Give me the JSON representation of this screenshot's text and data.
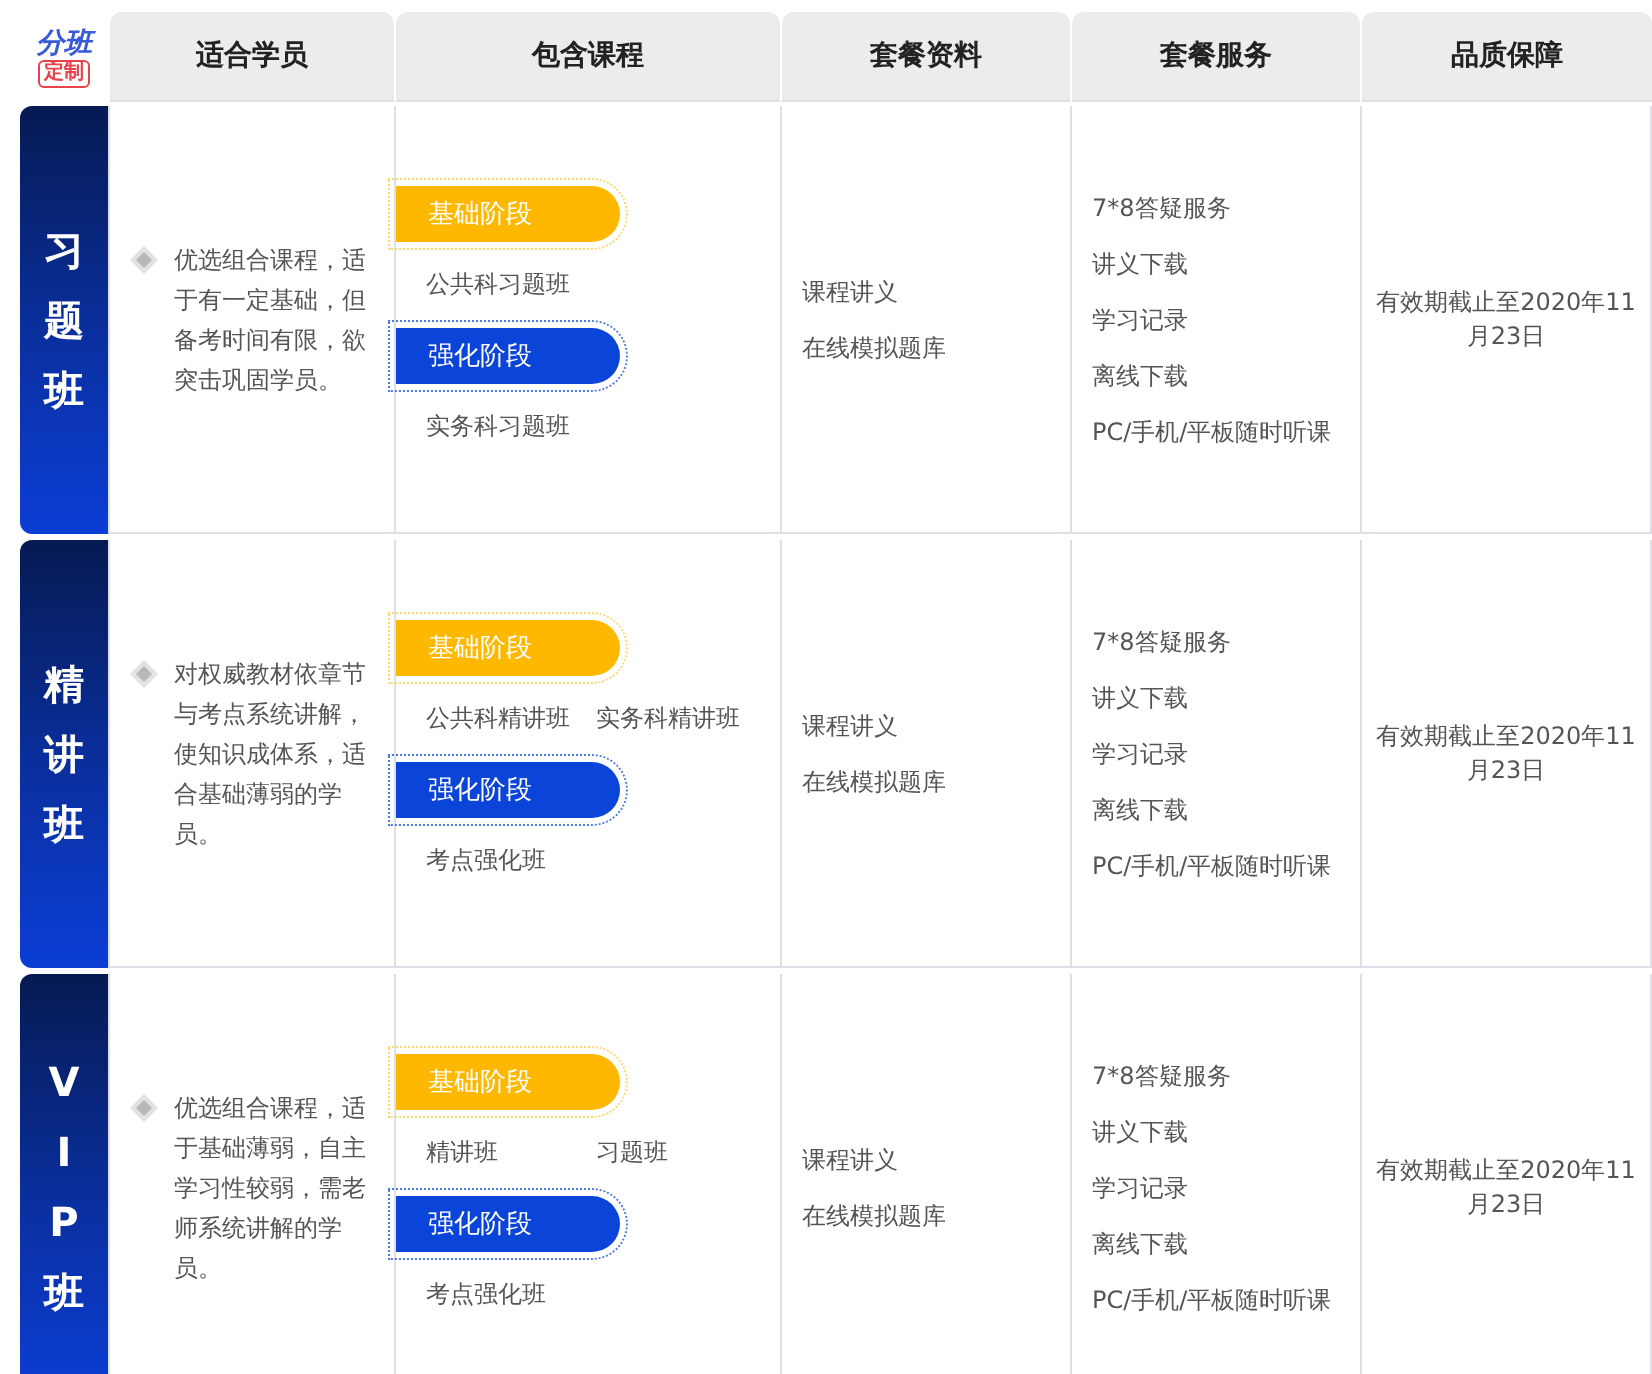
{
  "logo": {
    "top": "分班",
    "bottom": "定制"
  },
  "columns": [
    "适合学员",
    "包含课程",
    "套餐资料",
    "套餐服务",
    "品质保障"
  ],
  "rows": [
    {
      "name": "习题班",
      "audience": "优选组合课程，适于有一定基础，但备考时间有限，欲突击巩固学员。",
      "stages": [
        {
          "label": "基础阶段",
          "kind": "basic",
          "courses": [
            "公共科习题班"
          ]
        },
        {
          "label": "强化阶段",
          "kind": "intensive",
          "courses": [
            "实务科习题班"
          ]
        }
      ],
      "materials": [
        "课程讲义",
        "在线模拟题库"
      ],
      "services": [
        "7*8答疑服务",
        "讲义下载",
        "学习记录",
        "离线下载",
        "PC/手机/平板随时听课"
      ],
      "guarantee": "有效期截止至2020年11月23日"
    },
    {
      "name": "精讲班",
      "audience": "对权威教材依章节与考点系统讲解，使知识成体系，适合基础薄弱的学员。",
      "stages": [
        {
          "label": "基础阶段",
          "kind": "basic",
          "courses": [
            "公共科精讲班",
            "实务科精讲班"
          ]
        },
        {
          "label": "强化阶段",
          "kind": "intensive",
          "courses": [
            "考点强化班"
          ]
        }
      ],
      "materials": [
        "课程讲义",
        "在线模拟题库"
      ],
      "services": [
        "7*8答疑服务",
        "讲义下载",
        "学习记录",
        "离线下载",
        "PC/手机/平板随时听课"
      ],
      "guarantee": "有效期截止至2020年11月23日"
    },
    {
      "name": "VIP班",
      "audience": "优选组合课程，适于基础薄弱，自主学习性较弱，需老师系统讲解的学员。",
      "stages": [
        {
          "label": "基础阶段",
          "kind": "basic",
          "courses": [
            "精讲班",
            "习题班"
          ]
        },
        {
          "label": "强化阶段",
          "kind": "intensive",
          "courses": [
            "考点强化班"
          ]
        }
      ],
      "materials": [
        "课程讲义",
        "在线模拟题库"
      ],
      "services": [
        "7*8答疑服务",
        "讲义下载",
        "学习记录",
        "离线下载",
        "PC/手机/平板随时听课"
      ],
      "guarantee": "有效期截止至2020年11月23日"
    }
  ]
}
